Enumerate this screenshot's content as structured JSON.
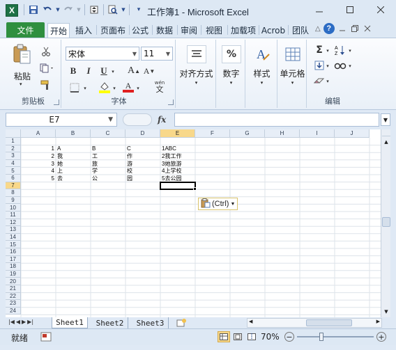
{
  "app": {
    "title": "工作簿1 - Microsoft Excel",
    "icon_letter": "X"
  },
  "tabs": [
    {
      "label": "文件"
    },
    {
      "label": "开始"
    },
    {
      "label": "插入"
    },
    {
      "label": "页面布"
    },
    {
      "label": "公式"
    },
    {
      "label": "数据"
    },
    {
      "label": "审阅"
    },
    {
      "label": "视图"
    },
    {
      "label": "加载项"
    },
    {
      "label": "Acrob"
    },
    {
      "label": "团队"
    }
  ],
  "ribbon": {
    "clipboard": {
      "label": "剪贴板",
      "paste": "粘贴"
    },
    "font": {
      "label": "字体",
      "name": "宋体",
      "size": "11",
      "bold": "B",
      "italic": "I",
      "underline": "U",
      "grow": "A",
      "shrink": "A",
      "wen": "wén"
    },
    "align": {
      "label": "对齐方式"
    },
    "number": {
      "label": "数字",
      "symbol": "%"
    },
    "styles": {
      "label": "样式"
    },
    "cells": {
      "label": "单元格"
    },
    "editing": {
      "label": "编辑"
    }
  },
  "formula": {
    "namebox": "E7",
    "fx": "fx",
    "value": ""
  },
  "columns": [
    "A",
    "B",
    "C",
    "D",
    "E",
    "F",
    "G",
    "H",
    "I",
    "J"
  ],
  "rows": [
    "1",
    "2",
    "3",
    "4",
    "5",
    "6",
    "7",
    "8",
    "9",
    "10",
    "11",
    "12",
    "13",
    "14",
    "15",
    "16",
    "17",
    "18",
    "19",
    "20",
    "21",
    "22",
    "23",
    "24"
  ],
  "cells": {
    "r2": [
      "1",
      "A",
      "B",
      "C",
      "1ABC"
    ],
    "r3": [
      "2",
      "我",
      "工",
      "作",
      "2我工作"
    ],
    "r4": [
      "3",
      "她",
      "旅",
      "游",
      "3她旅游"
    ],
    "r5": [
      "4",
      "上",
      "学",
      "校",
      "4上学校"
    ],
    "r6": [
      "5",
      "去",
      "公",
      "园",
      "5去公园"
    ]
  },
  "paste_options": {
    "label": "(Ctrl)"
  },
  "sheets": [
    "Sheet1",
    "Sheet2",
    "Sheet3"
  ],
  "status": {
    "ready": "就绪",
    "zoom": "70%"
  },
  "colors": {
    "file_tab": "#2f8f3f",
    "selected_header": "#f8d88a",
    "font_color_red": "#e02020",
    "highlight_yellow": "#ffff00"
  }
}
